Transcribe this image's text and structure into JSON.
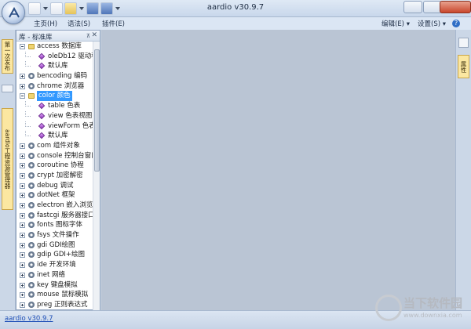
{
  "window": {
    "title": "aardio v30.9.7"
  },
  "menubar": {
    "items": [
      "主页(H)",
      "语法(S)",
      "插件(E)"
    ],
    "right": [
      "编辑(E) ▾",
      "设置(S) ▾"
    ]
  },
  "left_tabs": [
    "第一次发布",
    "aardio工程资源管理器"
  ],
  "panel": {
    "title": "库 - 标准库",
    "tree": [
      {
        "level": 0,
        "expander": "minus",
        "icon": "folder",
        "label": "access 数据库"
      },
      {
        "level": 1,
        "icon": "item",
        "label": "oleDb12 驱动程"
      },
      {
        "level": 1,
        "icon": "item",
        "label": "默认库"
      },
      {
        "level": 0,
        "expander": "plus",
        "icon": "gear",
        "label": "bencoding 编码"
      },
      {
        "level": 0,
        "expander": "plus",
        "icon": "gear",
        "label": "chrome 浏览器"
      },
      {
        "level": 0,
        "expander": "minus",
        "icon": "folder",
        "label": "color 颜色",
        "selected": true
      },
      {
        "level": 1,
        "icon": "item",
        "label": "table 色表"
      },
      {
        "level": 1,
        "icon": "item",
        "label": "view 色表视图"
      },
      {
        "level": 1,
        "icon": "item",
        "label": "viewForm 色表"
      },
      {
        "level": 1,
        "icon": "item",
        "label": "默认库"
      },
      {
        "level": 0,
        "expander": "plus",
        "icon": "gear",
        "label": "com 组件对象"
      },
      {
        "level": 0,
        "expander": "plus",
        "icon": "gear",
        "label": "console 控制台窗口"
      },
      {
        "level": 0,
        "expander": "plus",
        "icon": "gear",
        "label": "coroutine 协程"
      },
      {
        "level": 0,
        "expander": "plus",
        "icon": "gear",
        "label": "crypt 加密解密"
      },
      {
        "level": 0,
        "expander": "plus",
        "icon": "gear",
        "label": "debug 调试"
      },
      {
        "level": 0,
        "expander": "plus",
        "icon": "gear",
        "label": "dotNet 框架"
      },
      {
        "level": 0,
        "expander": "plus",
        "icon": "gear",
        "label": "electron 嵌入浏览器"
      },
      {
        "level": 0,
        "expander": "plus",
        "icon": "gear",
        "label": "fastcgi 服务器接口"
      },
      {
        "level": 0,
        "expander": "plus",
        "icon": "gear",
        "label": "fonts 图标字体"
      },
      {
        "level": 0,
        "expander": "plus",
        "icon": "gear",
        "label": "fsys 文件操作"
      },
      {
        "level": 0,
        "expander": "plus",
        "icon": "gear",
        "label": "gdi GDI绘图"
      },
      {
        "level": 0,
        "expander": "plus",
        "icon": "gear",
        "label": "gdip GDI+绘图"
      },
      {
        "level": 0,
        "expander": "plus",
        "icon": "gear",
        "label": "ide 开发环境"
      },
      {
        "level": 0,
        "expander": "plus",
        "icon": "gear",
        "label": "inet 网络"
      },
      {
        "level": 0,
        "expander": "plus",
        "icon": "gear",
        "label": "key 键盘模拟"
      },
      {
        "level": 0,
        "expander": "plus",
        "icon": "gear",
        "label": "mouse 鼠标模拟"
      },
      {
        "level": 0,
        "expander": "plus",
        "icon": "gear",
        "label": "preg 正则表达式"
      }
    ]
  },
  "right_tabs": [
    "属性"
  ],
  "status": {
    "link": "aardio v30.9.7"
  },
  "watermark": {
    "title": "当下软件园",
    "sub": "www.downxia.com"
  },
  "colors": {
    "selection": "#3399ff",
    "workspace": "#bac5d4",
    "chrome": "#dbe6f4"
  }
}
